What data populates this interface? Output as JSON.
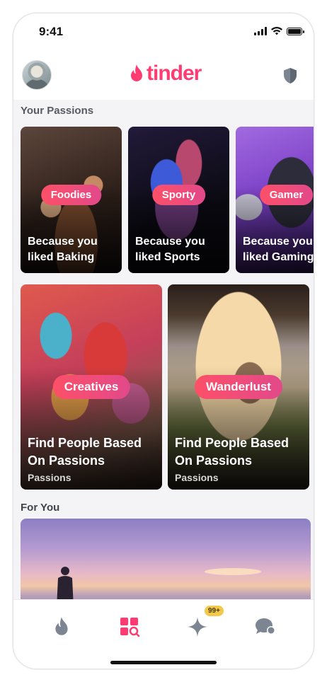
{
  "status": {
    "time": "9:41"
  },
  "header": {
    "logo_text": "tinder"
  },
  "sections": {
    "passions_title": "Your Passions",
    "for_you_title": "For You"
  },
  "passion_cards": [
    {
      "tag": "Foodies",
      "line1": "Because you",
      "line2": "liked Baking"
    },
    {
      "tag": "Sporty",
      "line1": "Because you",
      "line2": "liked Sports"
    },
    {
      "tag": "Gamer",
      "line1": "Because you",
      "line2": "liked Gaming"
    }
  ],
  "big_cards": [
    {
      "tag": "Creatives",
      "line1": "Find People Based",
      "line2": "On Passions",
      "sub": "Passions"
    },
    {
      "tag": "Wanderlust",
      "line1": "Find People Based",
      "line2": "On Passions",
      "sub": "Passions"
    }
  ],
  "tabbar": {
    "badge": "99+"
  },
  "colors": {
    "brand": "#fe3c72",
    "pill_start": "#fd5068",
    "pill_end": "#e2498a",
    "active_tab": "#fe3c72",
    "inactive_tab": "#7c8591",
    "badge": "#f2c94c"
  },
  "icons": [
    "flame-icon",
    "shield-icon",
    "explore-icon",
    "sparkle-icon",
    "chat-icon"
  ]
}
